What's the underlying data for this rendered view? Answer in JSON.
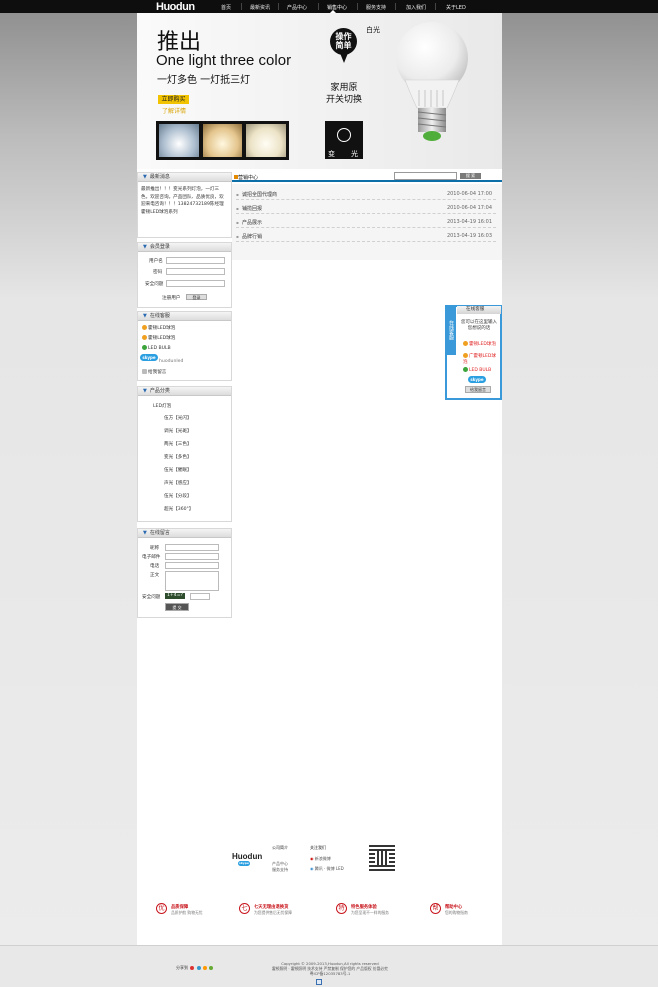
{
  "nav": {
    "logo": "Huodun",
    "items": [
      "首页",
      "最新资讯",
      "产品中心",
      "销售中心",
      "服务支持",
      "加入我们",
      "关于LED"
    ],
    "active": "销售中心"
  },
  "banner": {
    "title": "推出",
    "subtitle": "One light three color",
    "subtitle2": "一灯多色  一灯抵三灯",
    "buy_label": "立即购买",
    "buy_sub": "了解详情",
    "operation": "操作\n简单",
    "white_light": "白光",
    "feature": "家用原\n开关切换",
    "change_left": "变",
    "change_right": "光"
  },
  "sidebar": {
    "news": {
      "title": "最新消息",
      "text": "最新推出！！！变光系列灯泡，一灯三色，欢迎咨询。产品团队、品质优良，欢迎来电咨询！！！13824732189陈经理 霍顿LED球泡系列"
    },
    "member": {
      "title": "会员登录",
      "username_label": "用户名",
      "password_label": "密码",
      "question_label": "安全问题",
      "register_label": "注册用户",
      "login_btn": "登录"
    },
    "service": {
      "title": "在线客服",
      "items": [
        "霍顿LED球泡",
        "霍顿LED球泡",
        "LED BULB",
        "huodunled",
        "给我留言"
      ]
    },
    "categories": {
      "title": "产品分类",
      "root": "LED灯泡",
      "items": [
        "伍方【光闪】",
        "调光【光斑】",
        "两光【三色】",
        "变光【多色】",
        "伍光【催眠】",
        "声光【感应】",
        "伍光【分段】",
        "超光【360°】"
      ]
    },
    "message": {
      "title": "在线留言",
      "name_label": "昵称",
      "email_label": "电子邮件",
      "phone_label": "电话",
      "content_label": "正文",
      "question_label": "安全问题",
      "captcha": "1+4=?",
      "submit": "提 交"
    }
  },
  "main": {
    "section_title": "营销中心",
    "search_btn": "搜 索",
    "news": [
      {
        "title": "诚招全国代理商",
        "date": "2010-06-04 17:00"
      },
      {
        "title": "铺揽回报",
        "date": "2010-06-04 17:04"
      },
      {
        "title": "产品展示",
        "date": "2013-04-19 16:01"
      },
      {
        "title": "品牌行销",
        "date": "2013-04-19 16:03"
      }
    ]
  },
  "float_service": {
    "tab": "在线客服",
    "title": "在线客服",
    "text": "您可以在这里输入您想说的话",
    "items": [
      "霍顿LED球泡",
      "广霍顿LED球泡",
      "LED BULB"
    ],
    "leave_msg": "给我留言"
  },
  "footer": {
    "logo": "Huodun",
    "about_title": "公司简介",
    "about_links": [
      "产品中心",
      "服务支持"
    ],
    "follow_title": "关注我们",
    "follow_links": [
      "新浪微博",
      "腾讯 · 微博 LED"
    ],
    "promises": [
      {
        "icon": "优",
        "title": "品质保障",
        "sub": "品质护航 购物无忧"
      },
      {
        "icon": "七",
        "title": "七天无理由退换货",
        "sub": "为您提供售后无忧保障"
      },
      {
        "icon": "特",
        "title": "特色服务体验",
        "sub": "为您呈现不一样的服务"
      },
      {
        "icon": "帮",
        "title": "帮助中心",
        "sub": "您的购物指南"
      }
    ],
    "copyright": "Copyright © 2009-2013,Huodun,All rights reserved",
    "address": "霍顿照明 · 霍顿照明 技术支持 严禁复制 保护您的 产品版权 仿冒必究",
    "icp": "粤ICP备12035783号-1",
    "share_label": "分享到"
  }
}
